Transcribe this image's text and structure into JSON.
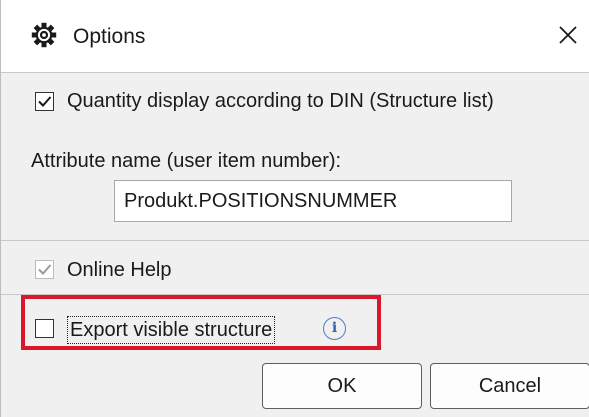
{
  "window": {
    "title": "Options",
    "icon": "gear-icon",
    "close_icon": "close-icon"
  },
  "options": {
    "quantity_din": {
      "label": "Quantity display according to DIN (Structure list)",
      "checked": true
    },
    "attribute_name_label": "Attribute name (user item number):",
    "attribute_name_value": "Produkt.POSITIONSNUMMER",
    "online_help": {
      "label": "Online Help",
      "checked": true,
      "disabled": true
    },
    "export_visible_structure": {
      "label": "Export visible structure",
      "checked": false,
      "info_icon": "info-icon",
      "info_glyph": "i"
    }
  },
  "buttons": {
    "ok": "OK",
    "cancel": "Cancel"
  },
  "colors": {
    "highlight": "#d9182d",
    "panel": "#f0f0f0",
    "info": "#2f62b4"
  }
}
